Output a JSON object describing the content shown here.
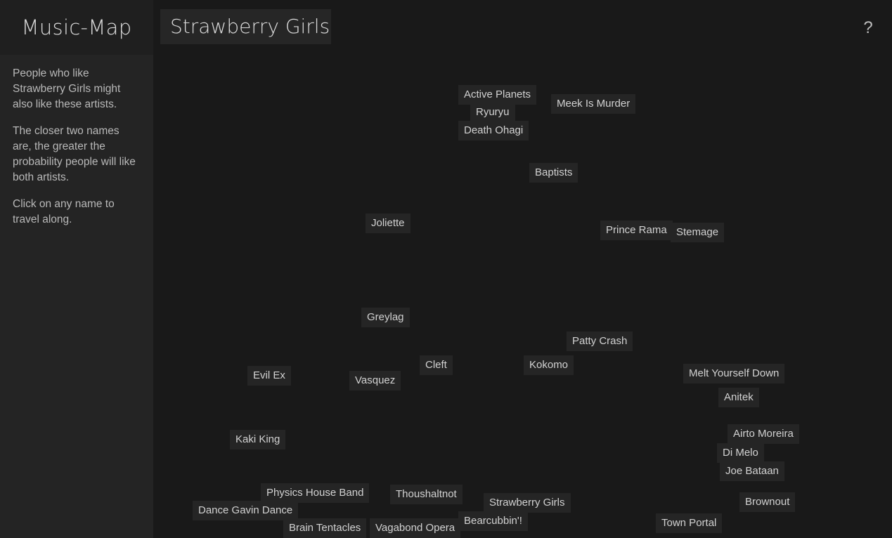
{
  "header": {
    "logo": "Music-Map",
    "search_value": "Strawberry Girls",
    "help_label": "?"
  },
  "sidebar": {
    "para1": "People who like Strawberry Girls might also like these artists.",
    "para2": "The closer two names are, the greater the probability people will like both artists.",
    "para3": "Click on any name to travel along."
  },
  "map": {
    "artists": [
      "Active Planets",
      "Meek Is Murder",
      "Ryuryu",
      "Death Ohagi",
      "Baptists",
      "Joliette",
      "Prince Rama",
      "Stemage",
      "Greylag",
      "Patty Crash",
      "Cleft",
      "Kokomo",
      "Evil Ex",
      "Vasquez",
      "Melt Yourself Down",
      "Anitek",
      "Kaki King",
      "Airto Moreira",
      "Di Melo",
      "Joe Bataan",
      "Physics House Band",
      "Thoushaltnot",
      "Strawberry Girls",
      "Brownout",
      "Dance Gavin Dance",
      "Bearcubbin'!",
      "Town Portal",
      "Brain Tentacles",
      "Vagabond Opera"
    ]
  }
}
